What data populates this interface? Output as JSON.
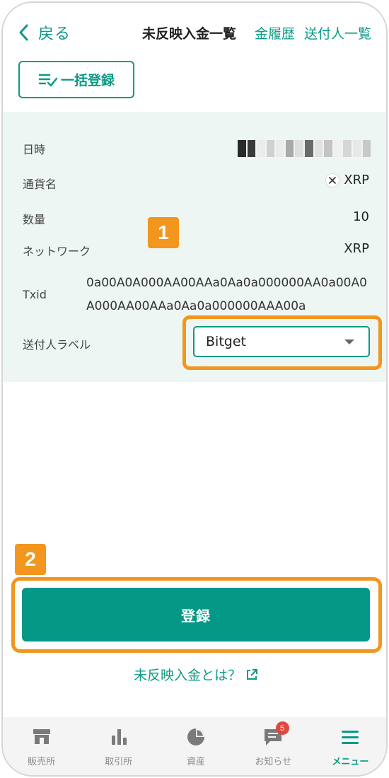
{
  "header": {
    "back_label": "戻る",
    "title_active": "未反映入金一覧",
    "tab_history": "金履歴",
    "tab_senders": "送付人一覧"
  },
  "bulk_button": {
    "label": "一括登録"
  },
  "detail": {
    "datetime": {
      "label": "日時",
      "value": ""
    },
    "currency": {
      "label": "通貨名",
      "value": "XRP",
      "icon": "xrp-icon"
    },
    "amount": {
      "label": "数量",
      "value": "10"
    },
    "network": {
      "label": "ネットワーク",
      "value": "XRP"
    },
    "txid": {
      "label": "Txid",
      "value": "0a00A0A000AA00AAa0Aa0a000000AA0a00A0A000AA00AAa0Aa0a000000AAA00a"
    },
    "sender_label": {
      "label": "送付人ラベル",
      "selected": "Bitget"
    }
  },
  "annotations": {
    "step1": "1",
    "step2": "2"
  },
  "register_button": {
    "label": "登録"
  },
  "help_link": {
    "label": "未反映入金とは？"
  },
  "nav": {
    "items": [
      {
        "label": "販売所",
        "icon": "shop-icon"
      },
      {
        "label": "取引所",
        "icon": "bar-chart-icon"
      },
      {
        "label": "資産",
        "icon": "pie-chart-icon"
      },
      {
        "label": "お知らせ",
        "icon": "message-icon",
        "badge": "5"
      },
      {
        "label": "メニュー",
        "icon": "hamburger-icon"
      }
    ]
  },
  "colors": {
    "accent": "#0b9a86",
    "button": "#069886",
    "highlight": "#f2961e",
    "panel": "#eef6f4"
  }
}
